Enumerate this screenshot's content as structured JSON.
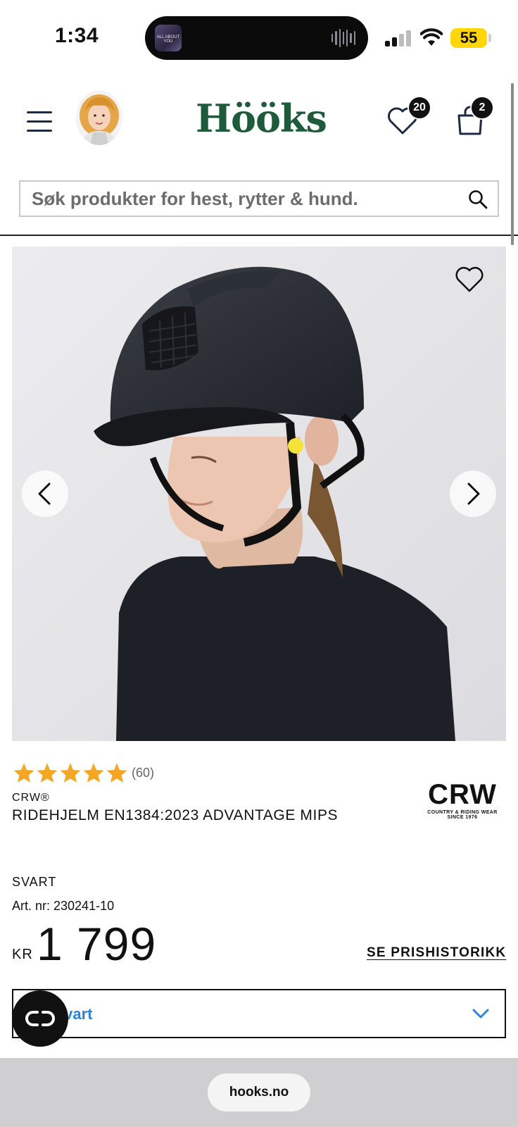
{
  "status_bar": {
    "time": "1:34",
    "now_playing_art_text": "ALL ABOUT YOU",
    "battery": "55"
  },
  "header": {
    "logo": "Hööks",
    "wishlist_count": "20",
    "cart_count": "2",
    "search_placeholder": "Søk produkter for hest, rytter & hund."
  },
  "gallery": {
    "icons": [
      "heart-icon",
      "chevron-left-icon",
      "chevron-right-icon"
    ]
  },
  "product": {
    "rating_value": 5,
    "rating_count": "(60)",
    "brand": "CRW®",
    "title": "RIDEHJELM EN1384:2023 ADVANTAGE MIPS",
    "brand_logo": {
      "mark": "CRW",
      "line1": "COUNTRY & RIDING WEAR",
      "line2": "SINCE 1976"
    },
    "color": "SVART",
    "article_number": "Art. nr: 230241-10",
    "currency": "KR",
    "price": "1 799",
    "price_history_link": "SE PRISHISTORIKK",
    "variant_label": ": Svart"
  },
  "browser": {
    "url": "hooks.no"
  },
  "colors": {
    "brand_green": "#1d5b3b",
    "star": "#f5a623",
    "link_blue": "#2a83d8",
    "battery": "#ffd60a"
  }
}
